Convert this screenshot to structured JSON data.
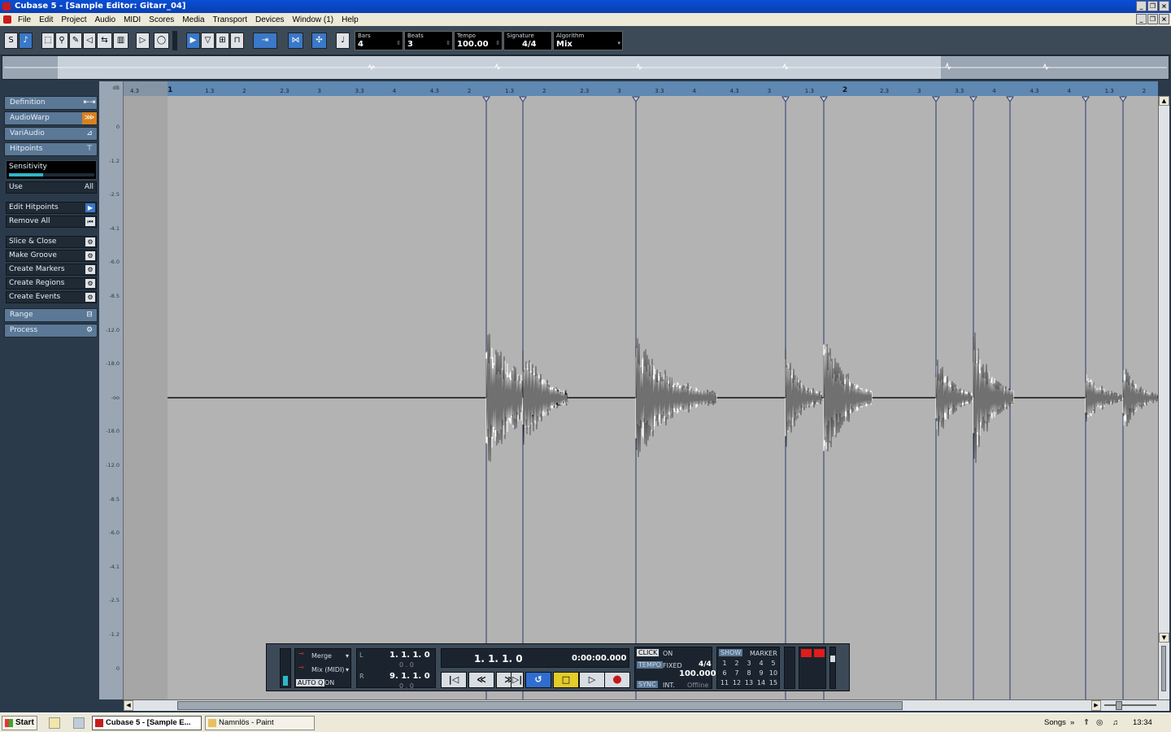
{
  "window": {
    "title": "Cubase 5 - [Sample Editor: Gitarr_04]",
    "controls": [
      "_",
      "❐",
      "×"
    ]
  },
  "menu": [
    "File",
    "Edit",
    "Project",
    "Audio",
    "MIDI",
    "Scores",
    "Media",
    "Transport",
    "Devices",
    "Window (1)",
    "Help"
  ],
  "toolbar": {
    "fields": [
      {
        "label": "Bars",
        "value": "4"
      },
      {
        "label": "Beats",
        "value": "3"
      },
      {
        "label": "Tempo",
        "value": "100.00"
      },
      {
        "label": "Signature",
        "value": "4/4"
      },
      {
        "label": "Algorithm",
        "value": "Mix"
      }
    ]
  },
  "inspector": {
    "sections": [
      {
        "label": "Definition",
        "icon": "resize-icon"
      },
      {
        "label": "AudioWarp",
        "icon": "warp-icon"
      },
      {
        "label": "VariAudio",
        "icon": "variaudio-icon"
      },
      {
        "label": "Hitpoints",
        "icon": "hitpoint-icon"
      }
    ],
    "sensitivity": {
      "label": "Sensitivity",
      "level": 0.4
    },
    "use": {
      "label": "Use",
      "value": "All"
    },
    "edit_buttons": [
      {
        "label": "Edit Hitpoints"
      },
      {
        "label": "Remove All"
      }
    ],
    "action_buttons": [
      {
        "label": "Slice & Close"
      },
      {
        "label": "Make Groove"
      },
      {
        "label": "Create Markers"
      },
      {
        "label": "Create Regions"
      },
      {
        "label": "Create Events"
      }
    ],
    "bottom_sections": [
      {
        "label": "Range"
      },
      {
        "label": "Process"
      }
    ]
  },
  "db_ruler": {
    "unit": "dB",
    "ticks": [
      "0",
      "-1.2",
      "-2.5",
      "-4.1",
      "-6.0",
      "-8.5",
      "-12.0",
      "-18.0",
      "-oo",
      "-18.0",
      "-12.0",
      "-8.5",
      "-6.0",
      "-4.1",
      "-2.5",
      "-1.2",
      "0"
    ]
  },
  "time_ruler": {
    "labels": [
      "4.3",
      "1",
      "1.3",
      "2",
      "2.3",
      "3",
      "3.3",
      "4",
      "4.3",
      "2",
      "1.3",
      "2",
      "2.3",
      "3",
      "3.3",
      "4",
      "4.3",
      "3",
      "1.3",
      "2",
      "2.3",
      "3",
      "3.3",
      "4",
      "4.3",
      "4",
      "1.3",
      "2"
    ],
    "bars": [
      "1",
      "2",
      "3",
      "4"
    ]
  },
  "transport": {
    "merge_label": "Merge",
    "mix_label": "Mix (MIDI)",
    "auto_q": "AUTO Q",
    "auto_q_state": "ON",
    "left_locator": "1. 1. 1. 0",
    "left_sub": "0 . 0",
    "right_locator": "9. 1. 1. 0",
    "right_sub": "0 . 0",
    "position": "1. 1. 1. 0",
    "time": "0:00:00.000",
    "click_label": "CLICK",
    "click_state": "ON",
    "tempo_label": "TEMPO",
    "tempo_mode": "FIXED",
    "signature": "4/4",
    "tempo_value": "100.000",
    "sync_label": "SYNC",
    "sync_source": "INT.",
    "sync_state": "Offline",
    "show_label": "SHOW",
    "marker_label": "MARKER",
    "markers": [
      "1",
      "2",
      "3",
      "4",
      "5",
      "6",
      "7",
      "8",
      "9",
      "10",
      "11",
      "12",
      "13",
      "14",
      "15"
    ]
  },
  "taskbar": {
    "start": "Start",
    "tasks": [
      "Cubase 5 - [Sample E...",
      "Namnlös - Paint"
    ],
    "tray_label": "Songs",
    "clock": "13:34"
  },
  "colors": {
    "panel": "#2b3a4a",
    "section": "#5b7896",
    "ruler": "#5f88b3",
    "waveform_bg": "#b3b3b3",
    "warp_accent": "#d6821f",
    "cycle_active": "#2f6ed0",
    "stop_active": "#e4cc2b"
  }
}
